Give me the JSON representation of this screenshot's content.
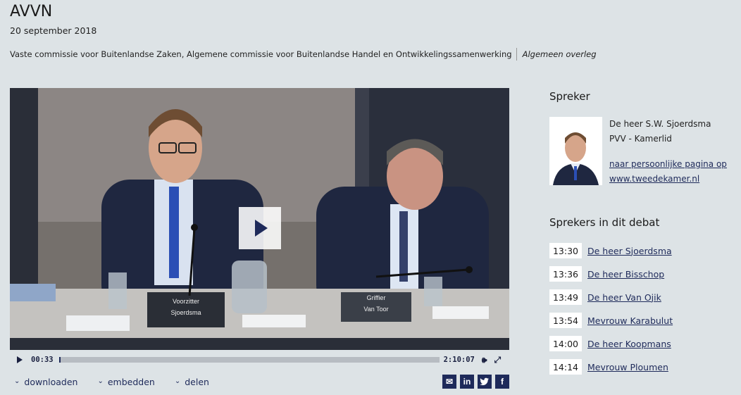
{
  "header": {
    "title": "AVVN",
    "date": "20 september 2018",
    "committee": "Vaste commissie voor Buitenlandse Zaken, Algemene commissie voor Buitenlandse Handel en Ontwikkelingssamenwerking",
    "meeting_type": "Algemeen overleg"
  },
  "video": {
    "placards": {
      "left_line1": "Voorzitter",
      "left_line2": "Sjoerdsma",
      "right_line1": "Griffier",
      "right_line2": "Van Toor"
    },
    "current_time": "00:33",
    "duration": "2:10:07",
    "progress_fraction": 0.004
  },
  "actions": {
    "download": "downloaden",
    "embed": "embedden",
    "share": "delen"
  },
  "share_icons": [
    "email-icon",
    "linkedin-icon",
    "twitter-icon",
    "facebook-icon"
  ],
  "share_glyphs": {
    "linkedin": "in",
    "facebook": "f"
  },
  "speaker": {
    "heading": "Spreker",
    "name": "De heer S.W. Sjoerdsma",
    "party": "PVV - Kamerlid",
    "link_line1": "naar persoonlijke pagina op",
    "link_line2": "www.tweedekamer.nl"
  },
  "debate": {
    "heading": "Sprekers in dit debat",
    "speakers": [
      {
        "time": "13:30",
        "name": "De heer Sjoerdsma"
      },
      {
        "time": "13:36",
        "name": "De heer Bisschop"
      },
      {
        "time": "13:49",
        "name": "De heer Van Ojik"
      },
      {
        "time": "13:54",
        "name": "Mevrouw Karabulut"
      },
      {
        "time": "14:00",
        "name": "De heer Koopmans"
      },
      {
        "time": "14:14",
        "name": "Mevrouw Ploumen"
      }
    ]
  },
  "colors": {
    "brand": "#1e2a5a",
    "background": "#dde3e6"
  }
}
